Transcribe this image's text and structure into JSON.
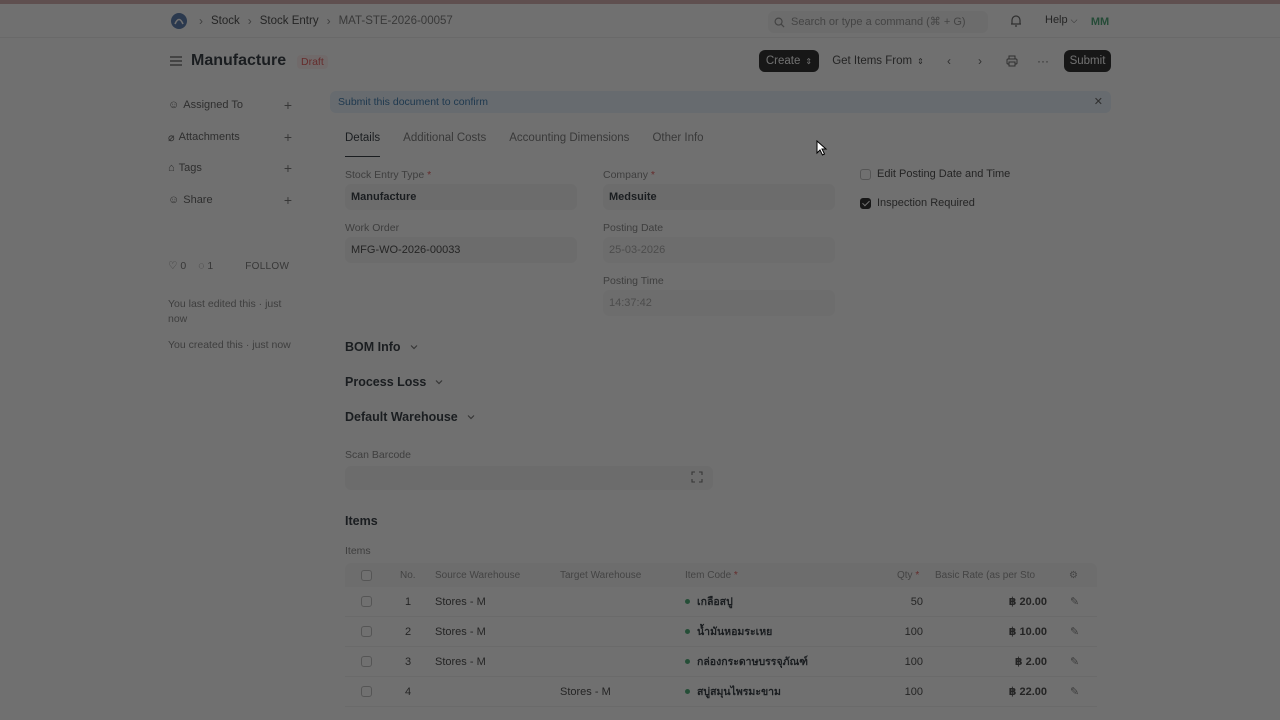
{
  "navbar": {
    "breadcrumbs": [
      "Stock",
      "Stock Entry",
      "MAT-STE-2026-00057"
    ],
    "search_placeholder": "Search or type a command (⌘ + G)",
    "help_label": "Help",
    "avatar_initials": "MM"
  },
  "page": {
    "title": "Manufacture",
    "status": "Draft",
    "create_label": "Create",
    "get_items_label": "Get Items From",
    "submit_label": "Submit"
  },
  "sidebar": {
    "items": [
      {
        "label": "Assigned To"
      },
      {
        "label": "Attachments"
      },
      {
        "label": "Tags"
      },
      {
        "label": "Share"
      }
    ],
    "likes": "0",
    "comments": "1",
    "follow_label": "FOLLOW",
    "activity": [
      "You last edited this · just now",
      "You created this · just now"
    ]
  },
  "alert": {
    "message": "Submit this document to confirm"
  },
  "tabs": [
    "Details",
    "Additional Costs",
    "Accounting Dimensions",
    "Other Info"
  ],
  "form": {
    "stock_entry_type_label": "Stock Entry Type",
    "stock_entry_type": "Manufacture",
    "work_order_label": "Work Order",
    "work_order": "MFG-WO-2026-00033",
    "company_label": "Company",
    "company": "Medsuite",
    "posting_date_label": "Posting Date",
    "posting_date": "25-03-2026",
    "posting_time_label": "Posting Time",
    "posting_time": "14:37:42",
    "edit_posting_label": "Edit Posting Date and Time",
    "inspection_label": "Inspection Required",
    "inspection_checked": true,
    "required_mark": "*"
  },
  "sections": [
    "BOM Info",
    "Process Loss",
    "Default Warehouse"
  ],
  "scan_barcode_label": "Scan Barcode",
  "items": {
    "title": "Items",
    "subtitle": "Items",
    "headers": [
      "No.",
      "Source Warehouse",
      "Target Warehouse",
      "Item Code",
      "Qty",
      "Basic Rate (as per Sto"
    ],
    "rows": [
      {
        "no": "1",
        "source": "Stores - M",
        "target": "",
        "code": "เกลือสปู",
        "qty": "50",
        "rate": "฿ 20.00"
      },
      {
        "no": "2",
        "source": "Stores - M",
        "target": "",
        "code": "น้ำมันหอมระเหย",
        "qty": "100",
        "rate": "฿ 10.00"
      },
      {
        "no": "3",
        "source": "Stores - M",
        "target": "",
        "code": "กล่องกระดาษบรรจุภัณฑ์",
        "qty": "100",
        "rate": "฿ 2.00"
      },
      {
        "no": "4",
        "source": "",
        "target": "Stores - M",
        "code": "สบู่สมุนไพรมะขาม",
        "qty": "100",
        "rate": "฿ 22.00"
      }
    ]
  }
}
